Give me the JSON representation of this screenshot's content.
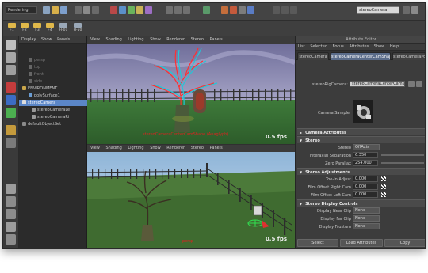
{
  "toolbar": {
    "mode": "Rendering",
    "search_value": "stereoCamera"
  },
  "shelf": {
    "buttons": [
      "F1",
      "F2",
      "F3",
      "F4",
      "H-01",
      "H-50"
    ]
  },
  "outliner": {
    "menu": [
      "Display",
      "Show",
      "Panels"
    ],
    "items": [
      "persp",
      "top",
      "front",
      "side",
      "ENVIRONMENT",
      "polySurface1",
      "stereoCamera",
      "stereoCameraLe",
      "stereoCameraRi",
      "defaultObjectSet"
    ]
  },
  "viewport_top": {
    "menu": [
      "View",
      "Shading",
      "Lighting",
      "Show",
      "Renderer",
      "Stereo",
      "Panels"
    ],
    "fps": "0.5 fps",
    "label": "stereoCameraCenterCamShape (Anaglyph)"
  },
  "viewport_bottom": {
    "menu": [
      "View",
      "Shading",
      "Lighting",
      "Show",
      "Renderer",
      "Stereo",
      "Panels"
    ],
    "fps": "0.5 fps",
    "label": "persp"
  },
  "attribute_editor": {
    "title": "Attribute Editor",
    "menu": [
      "List",
      "Selected",
      "Focus",
      "Attributes",
      "Show",
      "Help"
    ],
    "tabs": [
      "stereoCamera",
      "stereoCameraCenterCamShape",
      "stereoCameraPo"
    ],
    "rig_label": "stereoRigCamera:",
    "rig_value": "stereoCameraCenterCamShape",
    "sample_label": "Camera Sample",
    "sections": {
      "camera_attributes": "Camera Attributes",
      "stereo": "Stereo",
      "stereo_adjustments": "Stereo Adjustments",
      "stereo_display": "Stereo Display Controls"
    },
    "stereo_label": "Stereo",
    "stereo_value": "OffAxis",
    "interaxial_label": "Interaxial Separation",
    "interaxial_value": "6.350",
    "zero_parallax_label": "Zero Parallax",
    "zero_parallax_value": "254.000",
    "toe_label": "Toe-In Adjust",
    "toe_value": "0.000",
    "film_right_label": "Film Offset Right Cam",
    "film_right_value": "0.000",
    "film_left_label": "Film Offset Left Cam",
    "film_left_value": "0.000",
    "near_label": "Display Near Clip",
    "near_value": "None",
    "far_label": "Display Far Clip",
    "far_value": "None",
    "frustum_label": "Display Frustum",
    "frustum_value": "None",
    "select_label": "Select",
    "load_label": "Load Attributes",
    "copy_label": "Copy"
  }
}
